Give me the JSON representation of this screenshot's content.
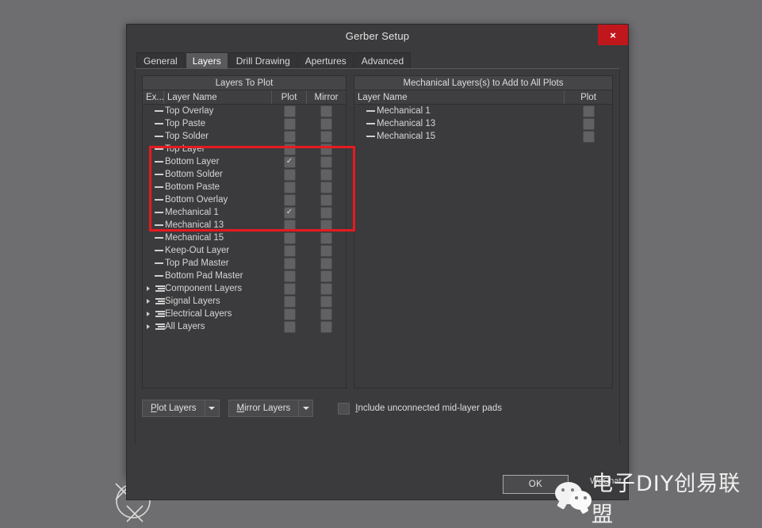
{
  "window": {
    "title": "Gerber Setup",
    "close_label": "×",
    "close_icon": "close-icon",
    "accent_red": "#c0171c",
    "background": "#3b3b3d",
    "canvas_background": "#6e6e70"
  },
  "tabs": [
    {
      "label": "General",
      "active": false
    },
    {
      "label": "Layers",
      "active": true
    },
    {
      "label": "Drill Drawing",
      "active": false
    },
    {
      "label": "Apertures",
      "active": false
    },
    {
      "label": "Advanced",
      "active": false
    }
  ],
  "left_panel": {
    "title": "Layers To Plot",
    "columns": [
      "Ex...",
      "Layer Name",
      "Plot",
      "Mirror"
    ],
    "rows": [
      {
        "name": "Top Overlay",
        "kind": "layer",
        "plot": false,
        "mirror": false
      },
      {
        "name": "Top Paste",
        "kind": "layer",
        "plot": false,
        "mirror": false
      },
      {
        "name": "Top Solder",
        "kind": "layer",
        "plot": false,
        "mirror": false
      },
      {
        "name": "Top Layer",
        "kind": "layer",
        "plot": false,
        "mirror": false
      },
      {
        "name": "Bottom Layer",
        "kind": "layer",
        "plot": true,
        "mirror": false
      },
      {
        "name": "Bottom Solder",
        "kind": "layer",
        "plot": false,
        "mirror": false
      },
      {
        "name": "Bottom Paste",
        "kind": "layer",
        "plot": false,
        "mirror": false
      },
      {
        "name": "Bottom Overlay",
        "kind": "layer",
        "plot": false,
        "mirror": false
      },
      {
        "name": "Mechanical 1",
        "kind": "layer",
        "plot": true,
        "mirror": false
      },
      {
        "name": "Mechanical 13",
        "kind": "layer",
        "plot": false,
        "mirror": false
      },
      {
        "name": "Mechanical 15",
        "kind": "layer",
        "plot": false,
        "mirror": false
      },
      {
        "name": "Keep-Out Layer",
        "kind": "layer",
        "plot": false,
        "mirror": false
      },
      {
        "name": "Top Pad Master",
        "kind": "layer",
        "plot": false,
        "mirror": false
      },
      {
        "name": "Bottom Pad Master",
        "kind": "layer",
        "plot": false,
        "mirror": false
      },
      {
        "name": "Component Layers",
        "kind": "group",
        "plot": false,
        "mirror": false
      },
      {
        "name": "Signal Layers",
        "kind": "group",
        "plot": false,
        "mirror": false
      },
      {
        "name": "Electrical Layers",
        "kind": "group",
        "plot": false,
        "mirror": false
      },
      {
        "name": "All Layers",
        "kind": "group",
        "plot": false,
        "mirror": false
      }
    ]
  },
  "right_panel": {
    "title": "Mechanical Layers(s) to Add to All Plots",
    "columns": [
      "Layer Name",
      "Plot"
    ],
    "rows": [
      {
        "name": "Mechanical 1",
        "plot": false
      },
      {
        "name": "Mechanical 13",
        "plot": false
      },
      {
        "name": "Mechanical 15",
        "plot": false
      }
    ]
  },
  "controls": {
    "plot_layers_label": "Plot Layers",
    "mirror_layers_label": "Mirror Layers",
    "include_pads_label": "Include unconnected mid-layer pads",
    "include_pads_checked": false
  },
  "footer": {
    "ok_label": "OK"
  },
  "annotation": {
    "highlight_color": "#e8191f",
    "note": "red-highlight-rectangle"
  },
  "watermark": {
    "text": "电子DIY创易联盟",
    "sub": "WeChat",
    "icon": "wechat-icon"
  }
}
